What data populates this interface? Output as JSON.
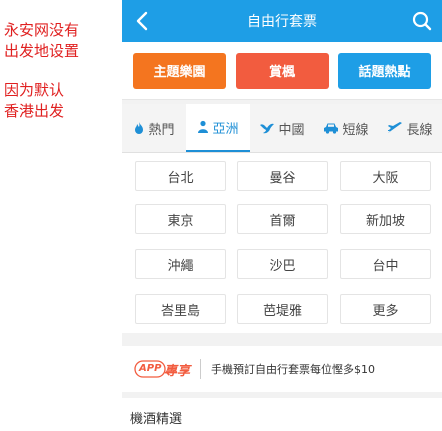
{
  "annotation": {
    "note1": "永安网没有\n出发地设置",
    "note2": "因为默认\n香港出发"
  },
  "header": {
    "title": "自由行套票",
    "bg_color": "#1e9ee6"
  },
  "categories": [
    {
      "label": "主題樂園",
      "color": "#f4751f"
    },
    {
      "label": "賞楓",
      "color": "#f25c3f"
    },
    {
      "label": "話題熱點",
      "color": "#1e9ee6"
    }
  ],
  "tabs": [
    {
      "label": "熱門",
      "icon": "flame-icon",
      "active": false
    },
    {
      "label": "亞洲",
      "icon": "person-icon",
      "active": true
    },
    {
      "label": "中國",
      "icon": "bird-icon",
      "active": false
    },
    {
      "label": "短線",
      "icon": "car-icon",
      "active": false
    },
    {
      "label": "長線",
      "icon": "plane-icon",
      "active": false
    }
  ],
  "cities": [
    "台北",
    "曼谷",
    "大阪",
    "東京",
    "首爾",
    "新加坡",
    "沖繩",
    "沙巴",
    "台中",
    "峇里島",
    "芭堤雅",
    "更多"
  ],
  "promo": {
    "badge_app": "APP",
    "badge_text": "專享",
    "text": "手機預訂自由行套票每位慳多$10"
  },
  "section": {
    "title": "機酒精選"
  }
}
